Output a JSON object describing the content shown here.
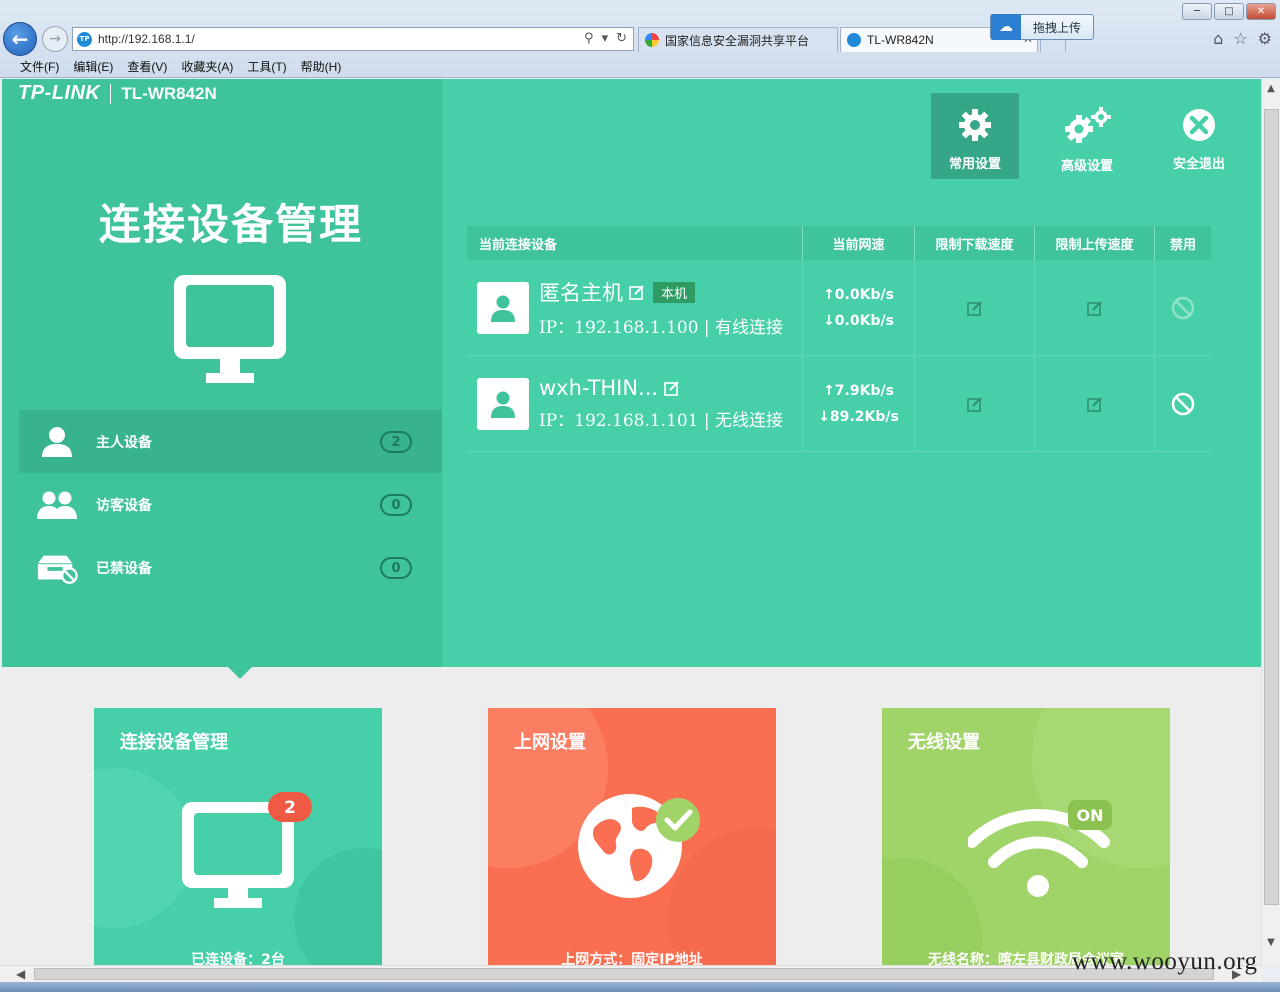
{
  "browser": {
    "url": "http://192.168.1.1/",
    "tabs": [
      {
        "label": "国家信息安全漏洞共享平台"
      },
      {
        "label": "TL-WR842N"
      }
    ],
    "upload_label": "拖拽上传",
    "favicon_text": "TP",
    "menu": [
      "文件(F)",
      "编辑(E)",
      "查看(V)",
      "收藏夹(A)",
      "工具(T)",
      "帮助(H)"
    ]
  },
  "router": {
    "brand": "TP-LINK",
    "model": "TL-WR842N",
    "page_title": "连接设备管理",
    "topnav": [
      {
        "label": "常用设置",
        "icon": "gear-icon",
        "active": true
      },
      {
        "label": "高级设置",
        "icon": "gears-icon",
        "active": false
      },
      {
        "label": "安全退出",
        "icon": "exit-icon",
        "active": false
      }
    ],
    "side": [
      {
        "label": "主人设备",
        "count": "2",
        "icon": "user-icon",
        "active": true
      },
      {
        "label": "访客设备",
        "count": "0",
        "icon": "users-icon",
        "active": false
      },
      {
        "label": "已禁设备",
        "count": "0",
        "icon": "blocked-box-icon",
        "active": false
      }
    ],
    "table": {
      "headers": [
        "当前连接设备",
        "当前网速",
        "限制下载速度",
        "限制上传速度",
        "禁用"
      ],
      "rows": [
        {
          "name": "匿名主机",
          "tag": "本机",
          "ip": "IP：192.168.1.100 | 有线连接",
          "up": "↑0.0Kb/s",
          "down": "↓0.0Kb/s",
          "block_disabled": true
        },
        {
          "name": "wxh-THIN...",
          "tag": "",
          "ip": "IP：192.168.1.101 | 无线连接",
          "up": "↑7.9Kb/s",
          "down": "↓89.2Kb/s",
          "block_disabled": false
        }
      ]
    },
    "cards": [
      {
        "title": "连接设备管理",
        "footer": "已连设备：2台",
        "badge": "2",
        "color": "#46cfa9"
      },
      {
        "title": "上网设置",
        "footer": "上网方式：固定IP地址",
        "color": "#fa6e52"
      },
      {
        "title": "无线设置",
        "footer": "无线名称：喀左县财政局会议室",
        "badge": "ON",
        "color": "#a0d468"
      }
    ]
  },
  "watermark": "www.wooyun.org",
  "colors": {
    "accent": "#46cfa9",
    "panel": "#3ec39d",
    "orange": "#fa6e52",
    "green": "#a0d468"
  }
}
